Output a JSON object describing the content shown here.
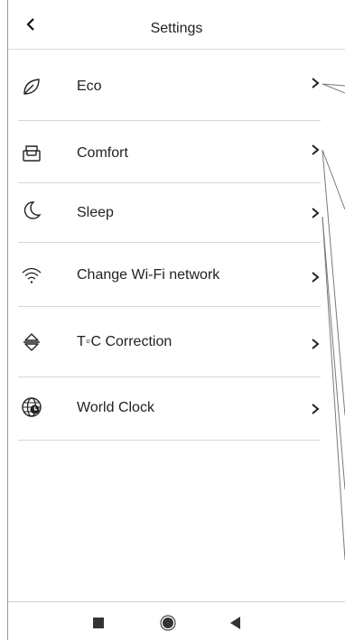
{
  "header": {
    "title": "Settings",
    "back_icon": "chevron-left-icon"
  },
  "menu": {
    "items": [
      {
        "label": "Eco",
        "icon": "leaf-icon"
      },
      {
        "label": "Comfort",
        "icon": "armchair-icon"
      },
      {
        "label": "Sleep",
        "icon": "moon-icon"
      },
      {
        "label": "Change Wi-Fi network",
        "icon": "wifi-icon"
      },
      {
        "label": "T◦C Correction",
        "icon": "up-down-arrows-icon"
      },
      {
        "label": "World Clock",
        "icon": "world-clock-icon"
      }
    ]
  },
  "navbar": {
    "items": [
      "recents-square-icon",
      "home-circle-icon",
      "back-triangle-icon"
    ]
  }
}
